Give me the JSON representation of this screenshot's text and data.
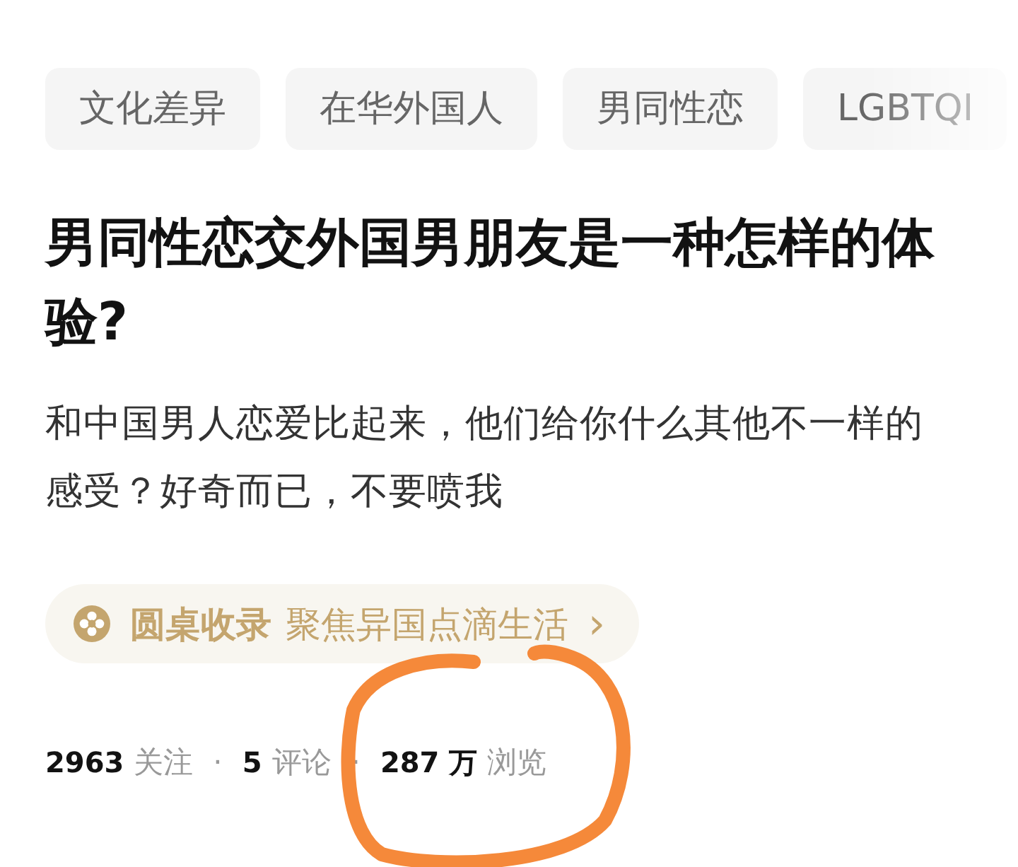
{
  "tags": [
    {
      "label": "文化差异"
    },
    {
      "label": "在华外国人"
    },
    {
      "label": "男同性恋"
    },
    {
      "label": "LGBTQI"
    }
  ],
  "question": {
    "title": "男同性恋交外国男朋友是一种怎样的体验?",
    "detail": "和中国男人恋爱比起来，他们给你什么其他不一样的感受？好奇而已，不要喷我"
  },
  "roundtable": {
    "label": "圆桌收录",
    "topic": "聚焦异国点滴生活",
    "arrow": "›"
  },
  "stats": [
    {
      "count": "2963",
      "unit": "关注"
    },
    {
      "count": "5",
      "unit": "评论"
    },
    {
      "count": "287 万",
      "unit": "浏览"
    }
  ],
  "stat_separator": "·",
  "annotation": {
    "kind": "circle"
  }
}
